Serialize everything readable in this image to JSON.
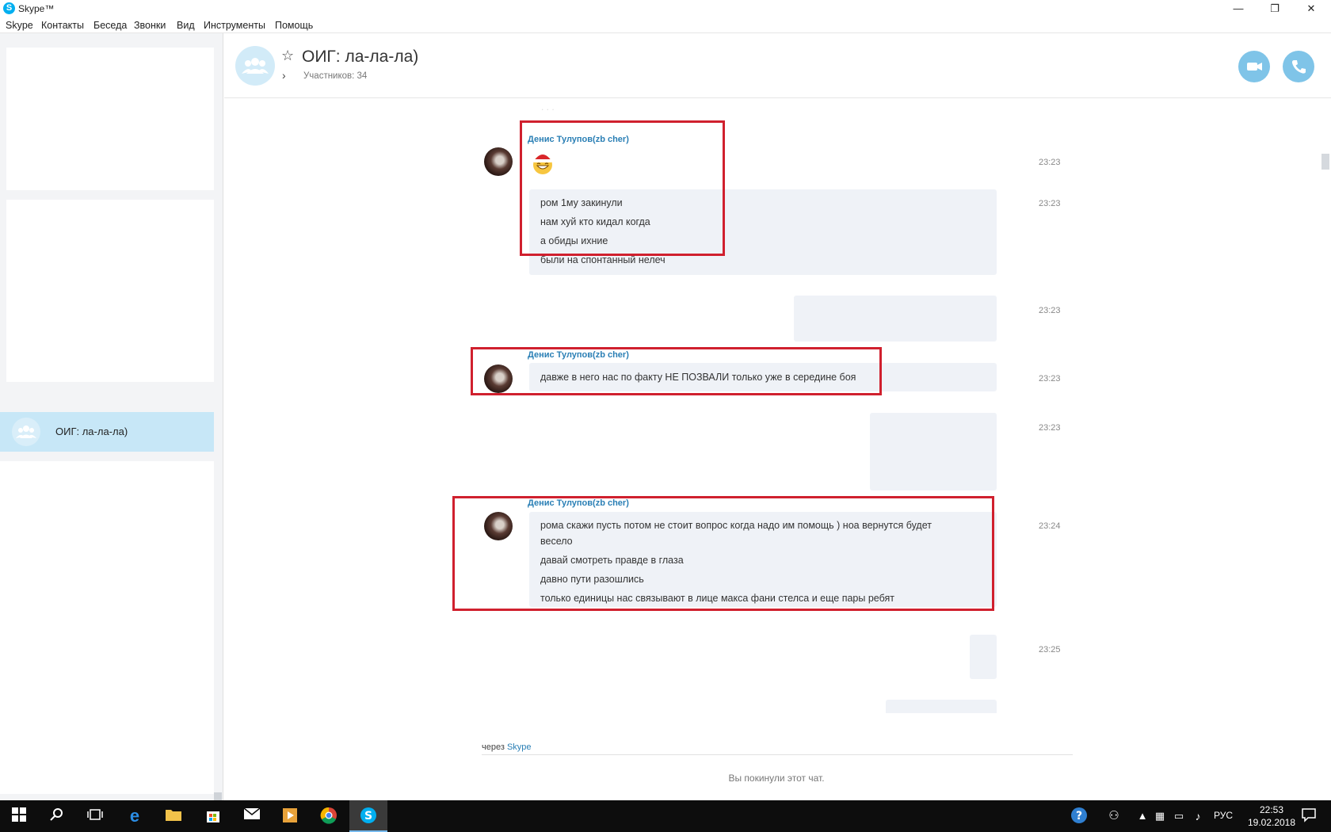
{
  "window": {
    "title": "Skype™",
    "minimize": "—",
    "restore": "❐",
    "close": "✕"
  },
  "menu": [
    "Skype",
    "Контакты",
    "Беседа",
    "Звонки",
    "Вид",
    "Инструменты",
    "Помощь"
  ],
  "sidebar": {
    "active_chat": "ОИГ: ла-ла-ла)"
  },
  "header": {
    "title": "ОИГ: ла-ла-ла)",
    "members": "Участников: 34"
  },
  "messages": {
    "m1": {
      "sender": "Денис Тулупов(zb cher)",
      "time_emoji": "23:23",
      "time": "23:23",
      "lines": [
        "ром 1му закинули",
        "нам хуй кто кидал когда",
        "а обиды ихние",
        "были на спонтанный нелеч"
      ]
    },
    "t_mid1": "23:23",
    "m2": {
      "sender": "Денис Тулупов(zb cher)",
      "time": "23:23",
      "lines": [
        "давже в него нас по факту НЕ ПОЗВАЛИ  только  уже в середине боя"
      ]
    },
    "t_mid2": "23:23",
    "m3": {
      "sender": "Денис Тулупов(zb cher)",
      "time": "23:24",
      "lines": [
        "рома скажи пусть потом не стоит вопрос когда надо им помощь  ) ноа вернутся будет",
        "весело",
        "давай смотреть правде в глаза",
        "давно пути разошлись",
        "только единицы нас связывают в лице макса фани стелса и еще пары ребят"
      ]
    },
    "t_last": "23:25"
  },
  "footer": {
    "via": "через",
    "via_link": "Skype",
    "left_note": "Вы покинули этот чат."
  },
  "taskbar": {
    "lang": "РУС",
    "time": "22:53",
    "date": "19.02.2018"
  }
}
